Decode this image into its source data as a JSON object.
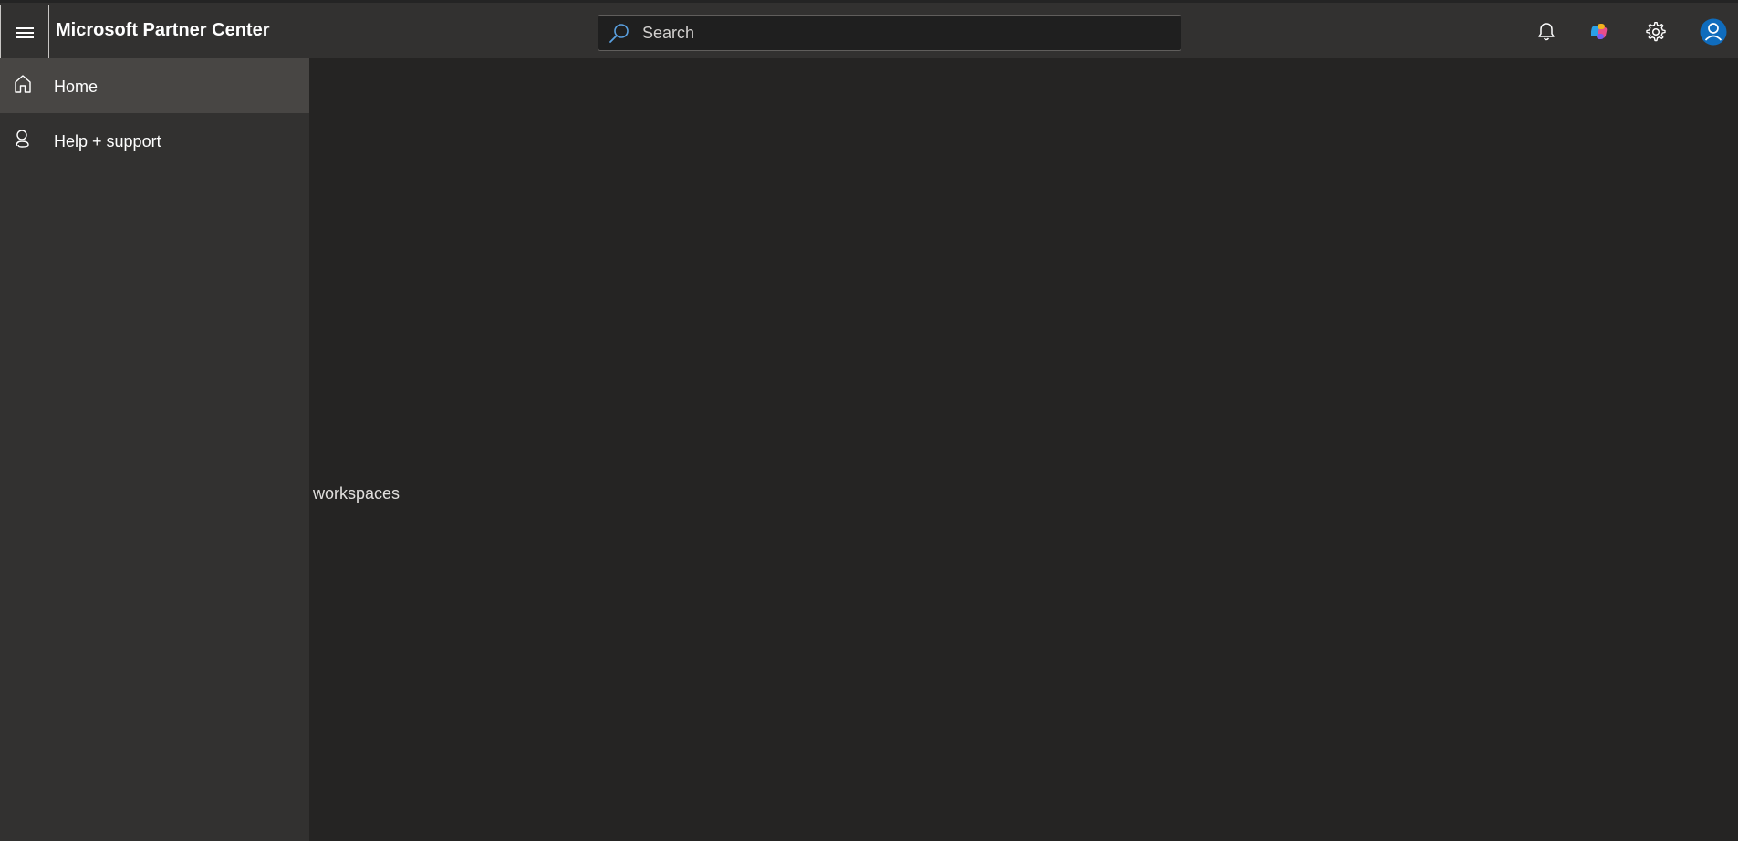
{
  "app": {
    "title": "Microsoft Partner Center"
  },
  "header": {
    "menu_icon": "hamburger-icon",
    "search": {
      "placeholder": "Search",
      "icon": "search-icon"
    },
    "icons": [
      "bell-icon",
      "copilot-icon",
      "gear-icon",
      "user-avatar-icon"
    ],
    "accent_color": "#0f6cbd"
  },
  "sidebar": {
    "items": [
      {
        "label": "Home",
        "icon": "home-icon",
        "selected": true
      },
      {
        "label": "Help + support",
        "icon": "help-support-icon",
        "selected": false
      }
    ]
  },
  "main": {
    "placeholder_text": "workspaces"
  }
}
